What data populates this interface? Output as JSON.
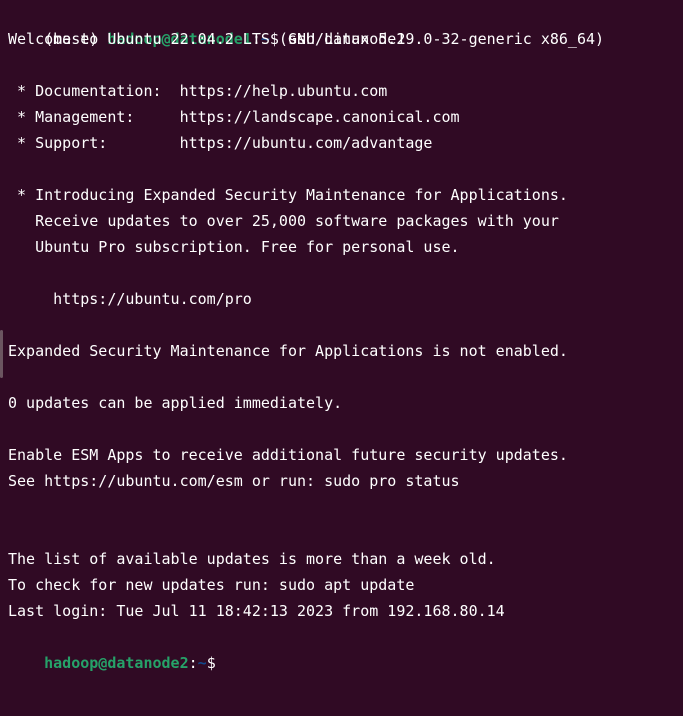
{
  "terminal": {
    "prompt1": {
      "env": "(base) ",
      "user_host": "hadoop@datanode1",
      "colon": ":",
      "path": "~",
      "symbol": "$ ",
      "command": "ssh datanode2"
    },
    "welcome": "Welcome to Ubuntu 22.04.2 LTS (GNU/Linux 5.19.0-32-generic x86_64)",
    "documentation": " * Documentation:  https://help.ubuntu.com",
    "management": " * Management:     https://landscape.canonical.com",
    "support": " * Support:        https://ubuntu.com/advantage",
    "esm_intro_1": " * Introducing Expanded Security Maintenance for Applications.",
    "esm_intro_2": "   Receive updates to over 25,000 software packages with your",
    "esm_intro_3": "   Ubuntu Pro subscription. Free for personal use.",
    "pro_url": "     https://ubuntu.com/pro",
    "esm_status": "Expanded Security Maintenance for Applications is not enabled.",
    "updates_count": "0 updates can be applied immediately.",
    "esm_apps_1": "Enable ESM Apps to receive additional future security updates.",
    "esm_apps_2": "See https://ubuntu.com/esm or run: sudo pro status",
    "updates_old_1": "The list of available updates is more than a week old.",
    "updates_old_2": "To check for new updates run: sudo apt update",
    "last_login": "Last login: Tue Jul 11 18:42:13 2023 from 192.168.80.14",
    "prompt2": {
      "user_host": "hadoop@datanode2",
      "colon": ":",
      "path": "~",
      "symbol": "$"
    }
  },
  "colors": {
    "background": "#300a24",
    "text": "#ffffff",
    "user_host": "#26a269",
    "path": "#12488b"
  }
}
